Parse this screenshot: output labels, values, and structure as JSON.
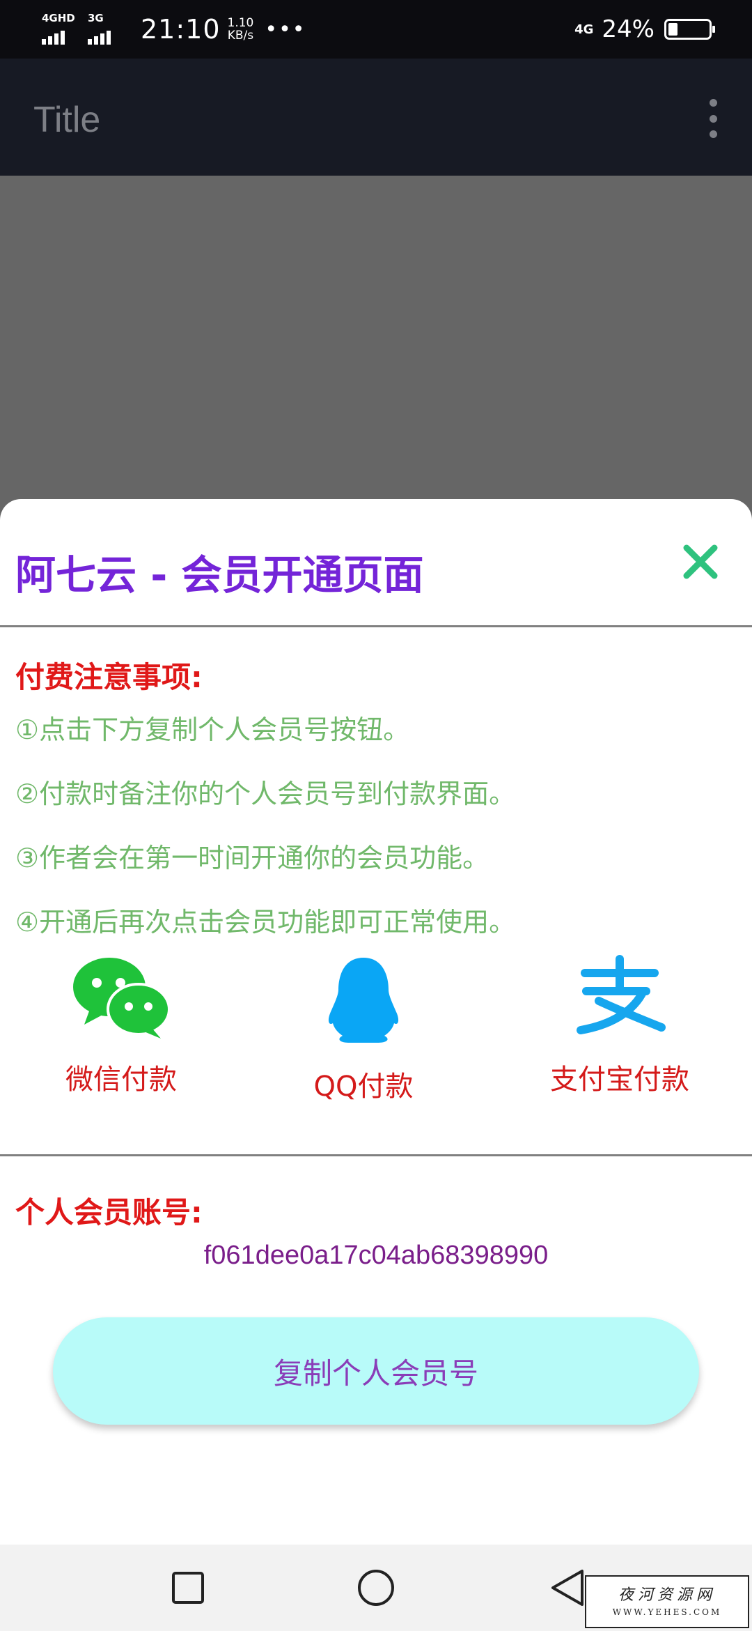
{
  "status_bar": {
    "network1": "4GHD",
    "network2": "3G",
    "time": "21:10",
    "speed_value": "1.10",
    "speed_unit": "KB/s",
    "more": "•••",
    "signal_right": "4G",
    "battery_percent": "24%",
    "battery_level": 0.24
  },
  "app_bar": {
    "title": "Title",
    "overflow_icon": "more-vert-icon"
  },
  "dialog": {
    "title": "阿七云 - 会员开通页面",
    "close_icon": "close-icon",
    "notice_heading": "付费注意事项:",
    "steps": [
      "①点击下方复制个人会员号按钮。",
      "②付款时备注你的个人会员号到付款界面。",
      "③作者会在第一时间开通你的会员功能。",
      "④开通后再次点击会员功能即可正常使用。"
    ],
    "payment_options": [
      {
        "label": "微信付款",
        "icon": "wechat-icon",
        "color": "#1fc23a"
      },
      {
        "label": "QQ付款",
        "icon": "qq-penguin-icon",
        "color": "#0aa6f5"
      },
      {
        "label": "支付宝付款",
        "icon": "alipay-icon",
        "color": "#16a6ee"
      }
    ],
    "account_heading": "个人会员账号:",
    "account_value": "f061dee0a17c04ab68398990",
    "copy_button": "复制个人会员号"
  },
  "nav_bar": {
    "recent_icon": "square-icon",
    "home_icon": "circle-icon",
    "back_icon": "triangle-back-icon"
  },
  "watermark": {
    "line1": "夜河资源网",
    "line2": "WWW.YEHES.COM"
  },
  "colors": {
    "title_purple": "#7424d8",
    "close_green": "#2ec27e",
    "heading_red": "#e01818",
    "step_green": "#70b86a",
    "button_bg": "#b8fbf9",
    "button_text": "#8a3db8"
  }
}
